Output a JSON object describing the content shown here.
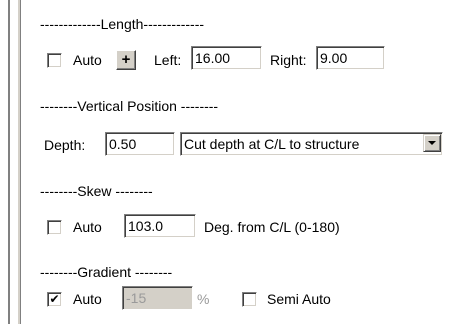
{
  "length_section": {
    "header": "-------------Length-------------",
    "auto_checked": false,
    "auto_label": "Auto",
    "plus_label": "+",
    "left_label": "Left:",
    "left_value": "16.00",
    "right_label": "Right:",
    "right_value": "9.00"
  },
  "vertical_section": {
    "header": "--------Vertical Position --------",
    "depth_label": "Depth:",
    "depth_value": "0.50",
    "mode_value": "Cut depth at C/L to structure"
  },
  "skew_section": {
    "header": "--------Skew --------",
    "auto_checked": false,
    "auto_label": "Auto",
    "value": "103.0",
    "unit_label": "Deg. from C/L (0-180)"
  },
  "gradient_section": {
    "header": "--------Gradient --------",
    "auto_checked": true,
    "auto_label": "Auto",
    "value": "-15",
    "percent_label": "%",
    "semi_auto_checked": false,
    "semi_auto_label": "Semi Auto"
  },
  "icons": {
    "checkmark": "✔"
  }
}
